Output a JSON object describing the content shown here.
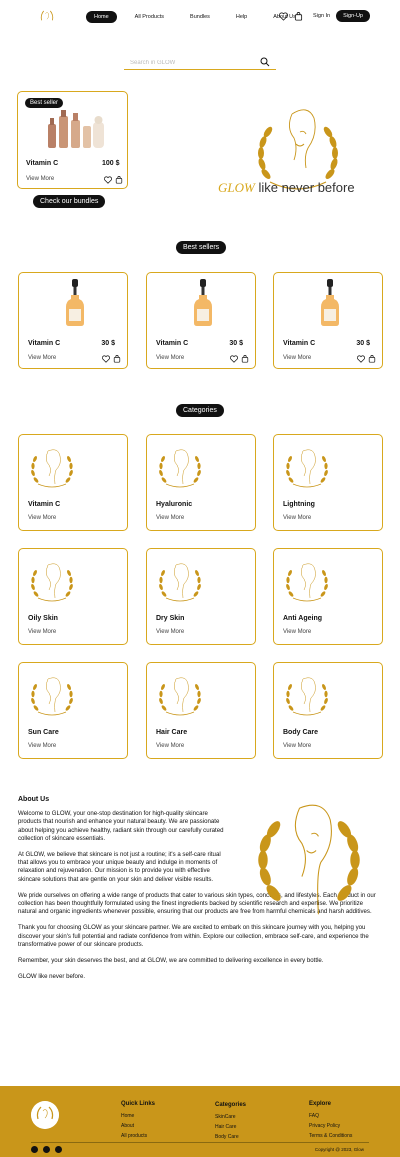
{
  "nav": {
    "links": [
      "Home",
      "All Products",
      "Bundles",
      "Help",
      "About Us"
    ],
    "signin": "Sign In",
    "signup": "Sign-Up"
  },
  "search": {
    "placeholder": "Search in GLOW"
  },
  "hero": {
    "badge": "Best seller",
    "product_title": "Vitamin C",
    "product_price": "100 $",
    "view_more": "View More",
    "bundles_button": "Check our bundles",
    "tagline_brand": "GLOW",
    "tagline_rest": " like never before"
  },
  "best_sellers": {
    "title": "Best sellers",
    "items": [
      {
        "name": "Vitamin C",
        "price": "30 $",
        "more": "View More"
      },
      {
        "name": "Vitamin C",
        "price": "30 $",
        "more": "View More"
      },
      {
        "name": "Vitamin C",
        "price": "30 $",
        "more": "View More"
      }
    ]
  },
  "categories": {
    "title": "Categories",
    "items": [
      {
        "name": "Vitamin C",
        "more": "View More"
      },
      {
        "name": "Hyaluronic",
        "more": "View More"
      },
      {
        "name": "Lightning",
        "more": "View More"
      },
      {
        "name": "Oily Skin",
        "more": "View More"
      },
      {
        "name": "Dry Skin",
        "more": "View More"
      },
      {
        "name": "Anti Ageing",
        "more": "View More"
      },
      {
        "name": "Sun Care",
        "more": "View More"
      },
      {
        "name": "Hair Care",
        "more": "View More"
      },
      {
        "name": "Body Care",
        "more": "View More"
      }
    ]
  },
  "about": {
    "title": "About Us",
    "p1": "Welcome to GLOW, your one-stop destination for high-quality skincare products that nourish and enhance your natural beauty. We are passionate about helping you achieve healthy, radiant skin through our carefully curated collection of skincare essentials.",
    "p2": "At GLOW, we believe that skincare is not just a routine; it's a self-care ritual that allows you to embrace your unique beauty and indulge in moments of relaxation and rejuvenation. Our mission is to provide you with effective skincare solutions that are gentle on your skin and deliver visible results.",
    "p3": "We pride ourselves on offering a wide range of products that cater to various skin types, concerns, and lifestyles. Each product in our collection has been thoughtfully formulated using the finest ingredients backed by scientific research and expertise. We prioritize natural and organic ingredients whenever possible, ensuring that our products are free from harmful chemicals and harsh additives.",
    "p4": "Thank you for choosing GLOW as your skincare partner. We are excited to embark on this skincare journey with you, helping you discover your skin's full potential and radiate confidence from within. Explore our collection, embrace self-care, and experience the transformative power of our skincare products.",
    "p5": "Remember, your skin deserves the best, and at GLOW, we are committed to delivering excellence in every bottle.",
    "p6": "GLOW like never before."
  },
  "footer": {
    "quick_links": {
      "title": "Quick Links",
      "items": [
        "Home",
        "About",
        "All products"
      ]
    },
    "categories": {
      "title": "Categories",
      "items": [
        "SkinCare",
        "Hair Care",
        "Body Care"
      ]
    },
    "explore": {
      "title": "Explore",
      "items": [
        "FAQ",
        "Privacy Policy",
        "Terms & Conditions"
      ]
    },
    "copyright": "Copyright @ 2023, Glow"
  },
  "colors": {
    "accent": "#c9961a",
    "border": "#d8a81e",
    "dark": "#111111"
  }
}
